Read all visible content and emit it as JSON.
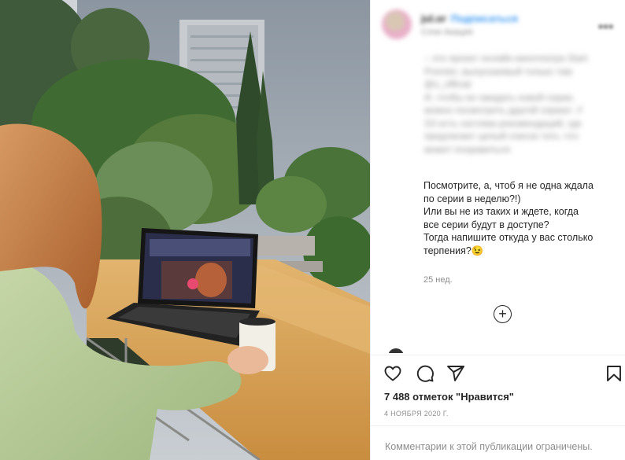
{
  "header": {
    "username": "jul.or",
    "follow_label": "Подписаться",
    "location": "Сочи Акация",
    "more_icon": "more-horizontal-icon"
  },
  "caption_blurred": [
    "– это проект онлайн-кинотеатра Start",
    "Premier, выпускаемый только там",
    "@o_official",
    "И, чтобы не ожидать новой серии,",
    "можно посмотреть другой сериал. У",
    "S3 есть система рекомендаций, где",
    "предлагают целый список того, что",
    "может понравиться."
  ],
  "caption_visible": [
    "Посмотрите, а, чтоб я не одна ждала",
    "по серии в неделю?!)",
    "Или вы не из таких и ждете, когда",
    "все серии будут в доступе?",
    "Тогда напишите откуда у вас столько",
    "терпения?😉"
  ],
  "time_ago": "25 нед.",
  "load_more_icon": "plus-circle-icon",
  "actions": {
    "like_icon": "heart-icon",
    "comment_icon": "comment-icon",
    "share_icon": "send-icon",
    "save_icon": "bookmark-icon"
  },
  "likes": "7 488 отметок \"Нравится\"",
  "post_date": "4 НОЯБРЯ 2020 Г.",
  "comments_closed": "Комментарии к этой публикации ограничены."
}
